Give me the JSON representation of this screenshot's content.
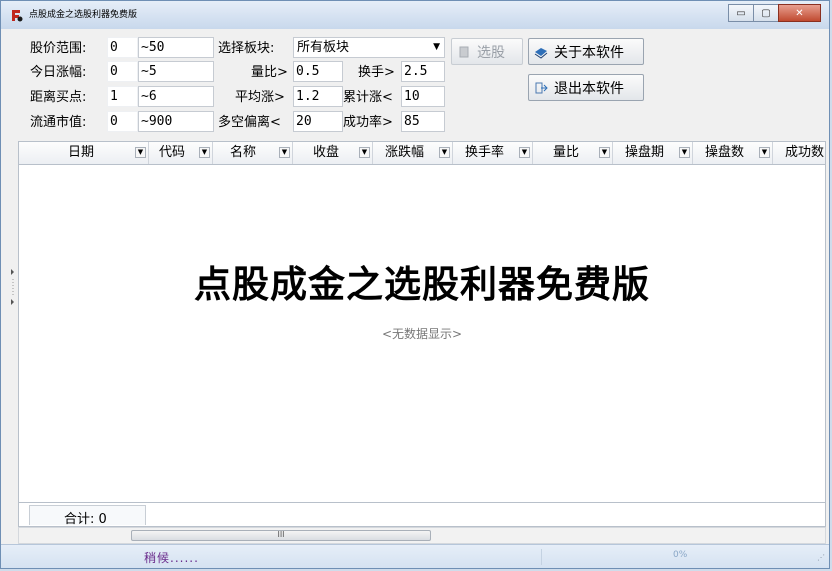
{
  "window": {
    "title": "点股成金之选股利器免费版",
    "controls": {
      "minimize": "▭",
      "maximize": "▢",
      "close": "✕"
    }
  },
  "form": {
    "price_range": {
      "label": "股价范围:",
      "min": "0",
      "sep": "~",
      "max": "50"
    },
    "today_change": {
      "label": "今日涨幅:",
      "min": "0",
      "sep": "~",
      "max": "5"
    },
    "buy_distance": {
      "label": "距离买点:",
      "min": "1",
      "sep": "~",
      "max": "6"
    },
    "float_cap": {
      "label": "流通市值:",
      "min": "0",
      "sep": "~",
      "max": "900"
    },
    "sector": {
      "label": "选择板块:",
      "value": "所有板块"
    },
    "volume_ratio": {
      "label": "量比>",
      "value": "0.5"
    },
    "turnover": {
      "label": "换手>",
      "value": "2.5"
    },
    "avg_rise": {
      "label": "平均涨>",
      "value": "1.2"
    },
    "cum_rise": {
      "label": "累计涨<",
      "value": "10"
    },
    "bull_bear_dev": {
      "label": "多空偏离<",
      "value": "20"
    },
    "success_rate": {
      "label": "成功率>",
      "value": "85"
    },
    "buttons": {
      "select": "选股",
      "about": "关于本软件",
      "exit": "退出本软件"
    }
  },
  "grid": {
    "columns": [
      "日期",
      "代码",
      "名称",
      "收盘",
      "涨跌幅",
      "换手率",
      "量比",
      "操盘期",
      "操盘数",
      "成功数"
    ],
    "watermark": "点股成金之选股利器免费版",
    "empty_text": "<无数据显示>",
    "summary": "合计: 0",
    "scroll_thumb": "III"
  },
  "status": {
    "text": "稍候......",
    "progress": "0%"
  },
  "icons": [
    "app-icon",
    "document-icon",
    "book-icon",
    "exit-icon",
    "dropdown-arrow-icon",
    "resize-grip-icon"
  ]
}
